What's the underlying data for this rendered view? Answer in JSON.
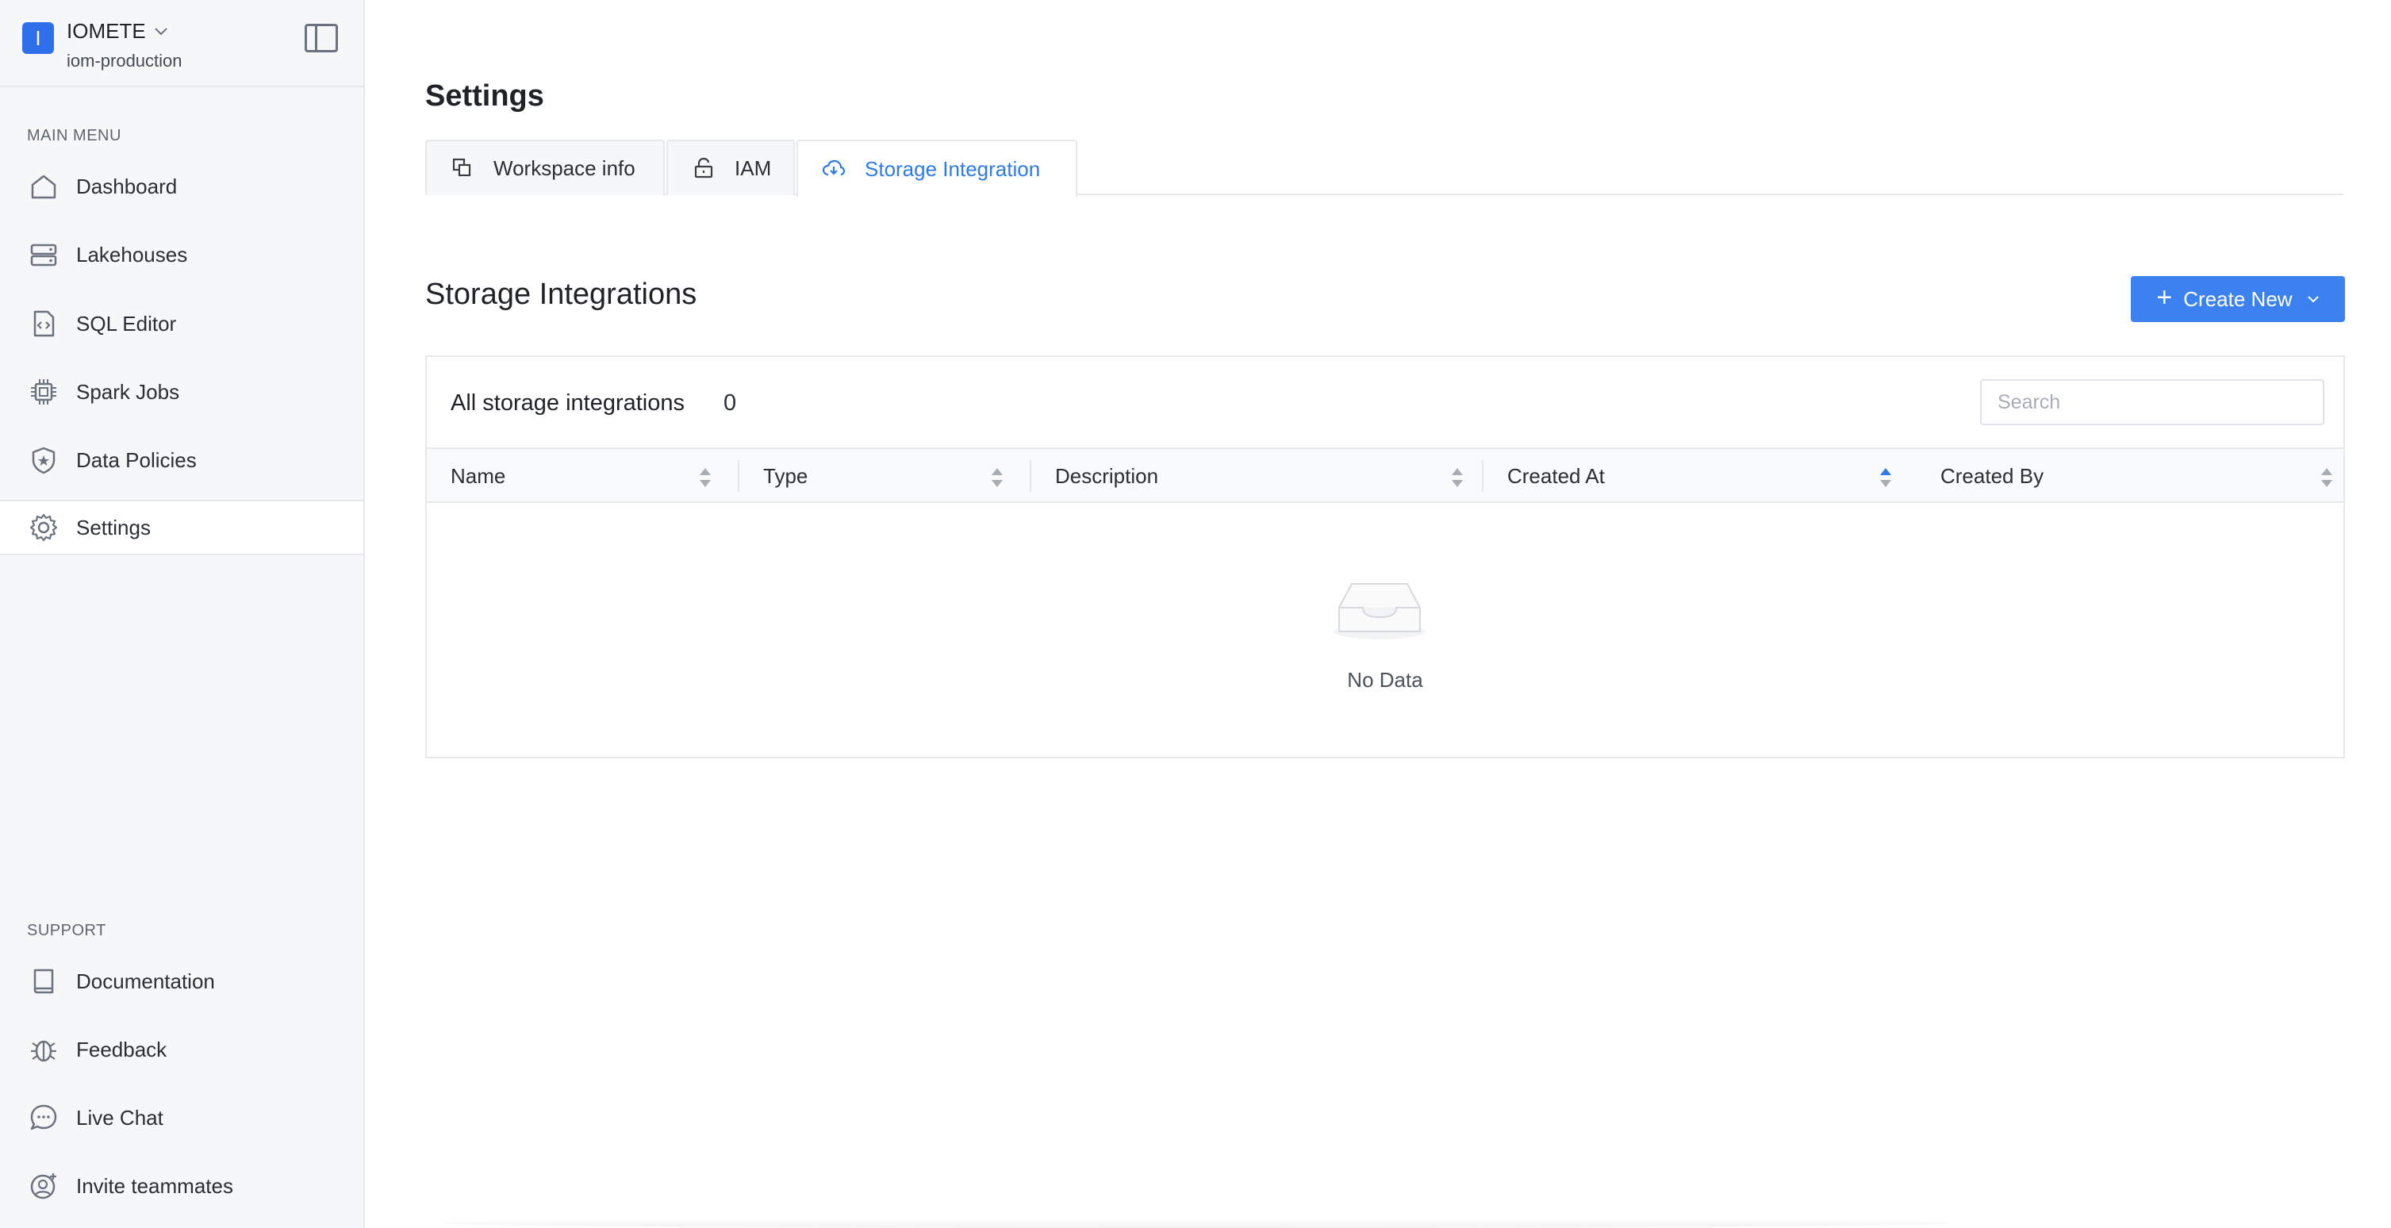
{
  "workspace": {
    "logo_letter": "I",
    "name": "IOMETE",
    "subtitle": "iom-production"
  },
  "sidebar": {
    "main_menu_label": "MAIN MENU",
    "main_items": [
      {
        "label": "Dashboard",
        "icon": "home-icon"
      },
      {
        "label": "Lakehouses",
        "icon": "server-icon"
      },
      {
        "label": "SQL Editor",
        "icon": "code-file-icon"
      },
      {
        "label": "Spark Jobs",
        "icon": "chip-icon"
      },
      {
        "label": "Data Policies",
        "icon": "shield-star-icon"
      },
      {
        "label": "Settings",
        "icon": "gear-icon",
        "active": true
      }
    ],
    "support_label": "SUPPORT",
    "support_items": [
      {
        "label": "Documentation",
        "icon": "book-icon"
      },
      {
        "label": "Feedback",
        "icon": "bug-icon"
      },
      {
        "label": "Live Chat",
        "icon": "chat-icon"
      },
      {
        "label": "Invite teammates",
        "icon": "user-add-icon"
      }
    ]
  },
  "page": {
    "title": "Settings",
    "tabs": [
      {
        "label": "Workspace info",
        "icon": "copy-icon"
      },
      {
        "label": "IAM",
        "icon": "lock-icon"
      },
      {
        "label": "Storage Integration",
        "icon": "cloud-download-icon",
        "active": true
      }
    ]
  },
  "storage": {
    "section_title": "Storage Integrations",
    "create_label": "Create New",
    "card_title": "All storage integrations",
    "count": "0",
    "search_placeholder": "Search",
    "columns": [
      "Name",
      "Type",
      "Description",
      "Created At",
      "Created By"
    ],
    "sorted_column": "Created At",
    "empty_text": "No Data"
  },
  "colors": {
    "accent": "#3b82f0",
    "active_tab_text": "#2f7be6",
    "sidebar_bg": "#f6f7f9"
  }
}
